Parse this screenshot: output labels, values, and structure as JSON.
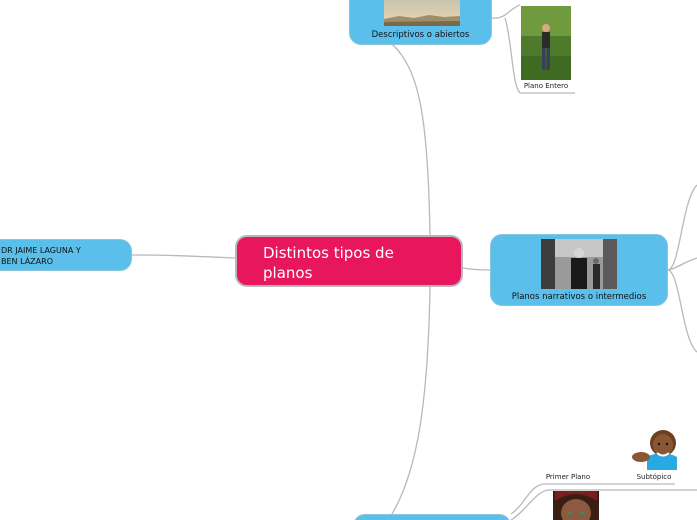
{
  "map": {
    "central": {
      "title": "Distintos tipos de planos"
    },
    "left_node": {
      "label": "DR JAIME LAGUNA Y\nBEN LÁZARO"
    },
    "top_node": {
      "label": "Descriptivos o abiertos"
    },
    "middle_node": {
      "label": "Planos narrativos o intermedios"
    },
    "captions": {
      "plano_entero": "Plano Entero",
      "primer_plano": "Primer Plano",
      "subtopico": "Subtópico"
    }
  },
  "colors": {
    "central": "#e8175d",
    "topic": "#5bbfec",
    "connector": "#b8b8bf"
  }
}
